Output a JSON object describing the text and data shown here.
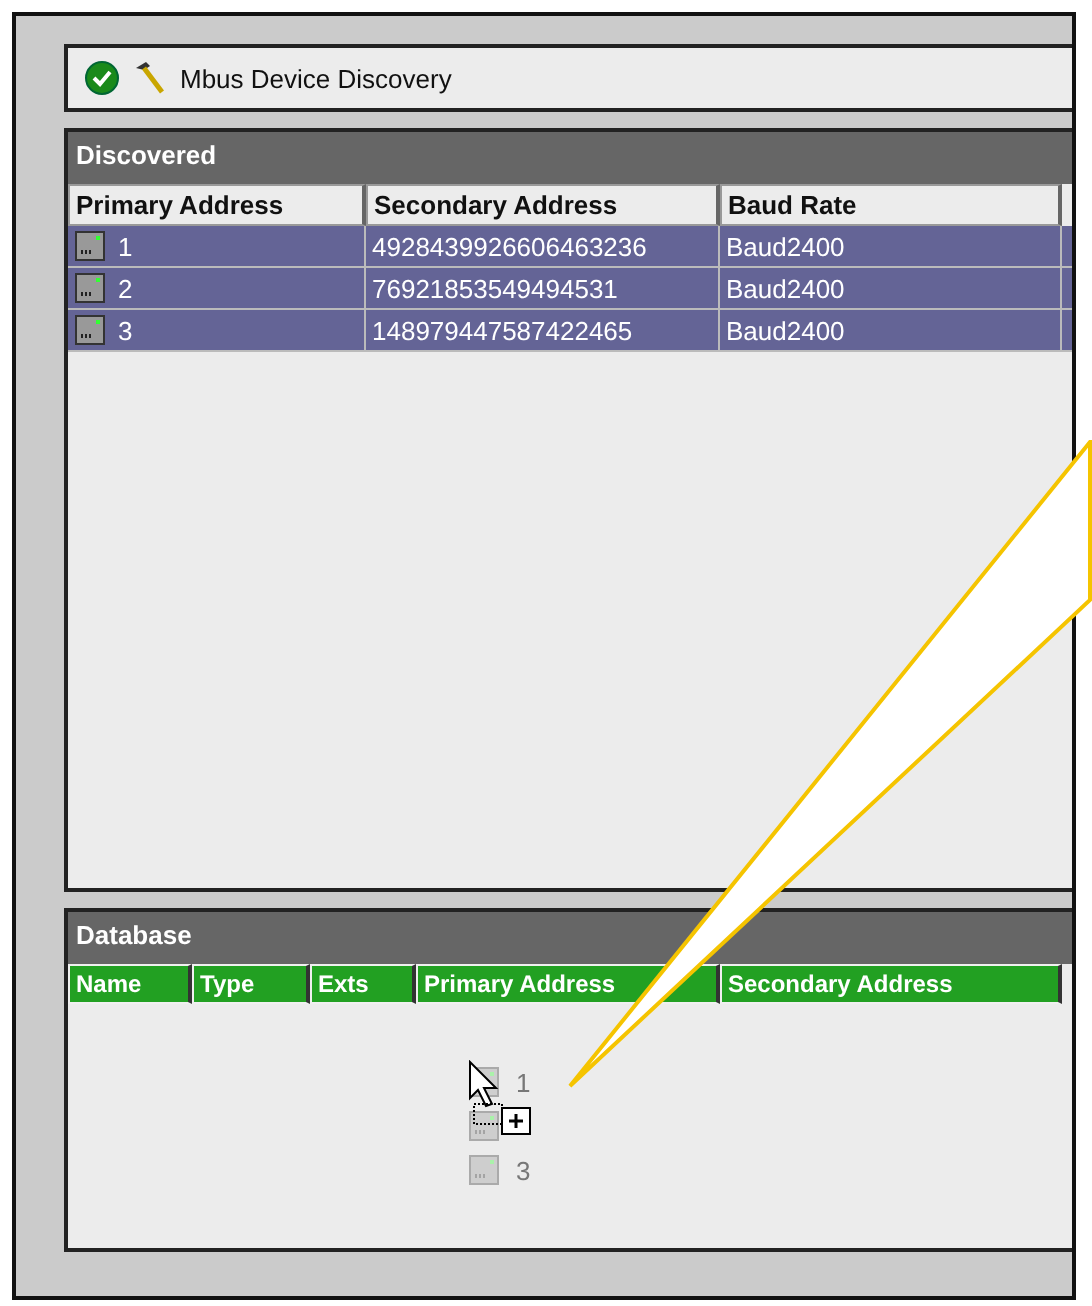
{
  "header": {
    "title": "Mbus Device Discovery"
  },
  "discovered": {
    "title": "Discovered",
    "columns": [
      "Primary Address",
      "Secondary Address",
      "Baud Rate"
    ],
    "rows": [
      {
        "primary": "1",
        "secondary": "4928439926606463236",
        "baud": "Baud2400",
        "selected": true
      },
      {
        "primary": "2",
        "secondary": "76921853549494531",
        "baud": "Baud2400",
        "selected": true
      },
      {
        "primary": "3",
        "secondary": "148979447587422465",
        "baud": "Baud2400",
        "selected": true
      }
    ]
  },
  "database": {
    "title": "Database",
    "columns": [
      "Name",
      "Type",
      "Exts",
      "Primary Address",
      "Secondary Address"
    ],
    "drag_items": [
      {
        "kind": "labeled",
        "label": "1"
      },
      {
        "kind": "covered"
      },
      {
        "kind": "labeled",
        "label": "3"
      }
    ]
  }
}
